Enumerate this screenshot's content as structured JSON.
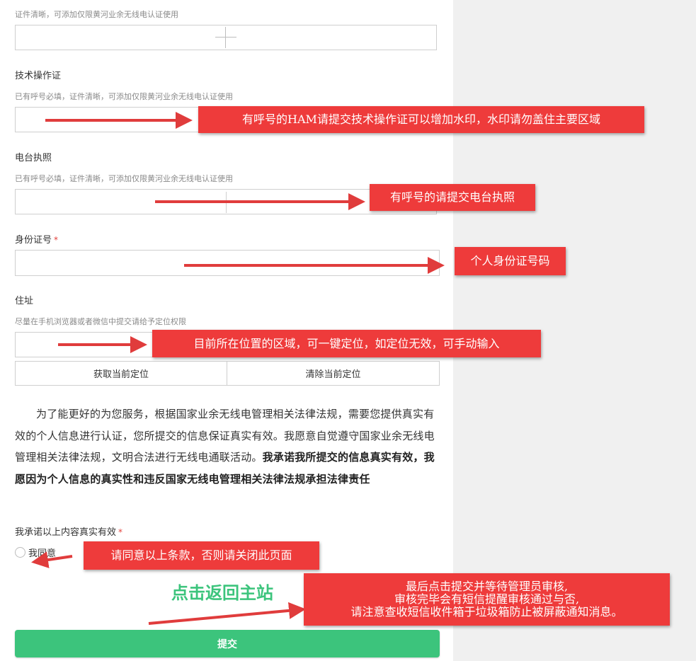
{
  "upload_top": {
    "hint": "证件清晰，可添加仅限黄河业余无线电认证使用"
  },
  "tech_cert": {
    "label": "技术操作证",
    "hint": "已有呼号必填，证件清晰，可添加仅限黄河业余无线电认证使用"
  },
  "station_license": {
    "label": "电台执照",
    "hint": "已有呼号必填，证件清晰，可添加仅限黄河业余无线电认证使用"
  },
  "id_number": {
    "label": "身份证号",
    "required_mark": "*",
    "value": ""
  },
  "address": {
    "label": "住址",
    "hint": "尽量在手机浏览器或者微信中提交请给予定位权限",
    "value": "",
    "get_location_label": "获取当前定位",
    "clear_location_label": "清除当前定位"
  },
  "statement": {
    "normal": "为了能更好的为您服务，根据国家业余无线电管理相关法律法规，需要您提供真实有效的个人信息进行认证，您所提交的信息保证真实有效。我愿意自觉遵守国家业余无线电管理相关法律法规，文明合法进行无线电通联活动。",
    "bold": "我承诺我所提交的信息真实有效，我愿因为个人信息的真实性和违反国家无线电管理相关法律法规承担法律责任"
  },
  "promise": {
    "label": "我承诺以上内容真实有效",
    "required_mark": "*",
    "option_label": "我同意"
  },
  "submit_label": "提交",
  "annotations": {
    "tech_cert_note": "有呼号的HAM请提交技术操作证可以增加水印，水印请勿盖住主要区域",
    "station_note": "有呼号的请提交电台执照",
    "id_note": "个人身份证号码",
    "location_note": "目前所在位置的区域，可一键定位，如定位无效，可手动输入",
    "agree_note": "请同意以上条款，否则请关闭此页面",
    "return_note": "点击返回主站",
    "final_note_line1": "最后点击提交并等待管理员审核,",
    "final_note_line2": "审核完毕会有短信提醒审核通过与否,",
    "final_note_line3": "请注意查收短信收件箱于垃圾箱防止被屏蔽通知消息。"
  },
  "colors": {
    "accent_green": "#3cc47c",
    "annotation_red": "#ee3b3b",
    "required_red": "#e3413b",
    "side_panel": "#f0f0f0"
  }
}
